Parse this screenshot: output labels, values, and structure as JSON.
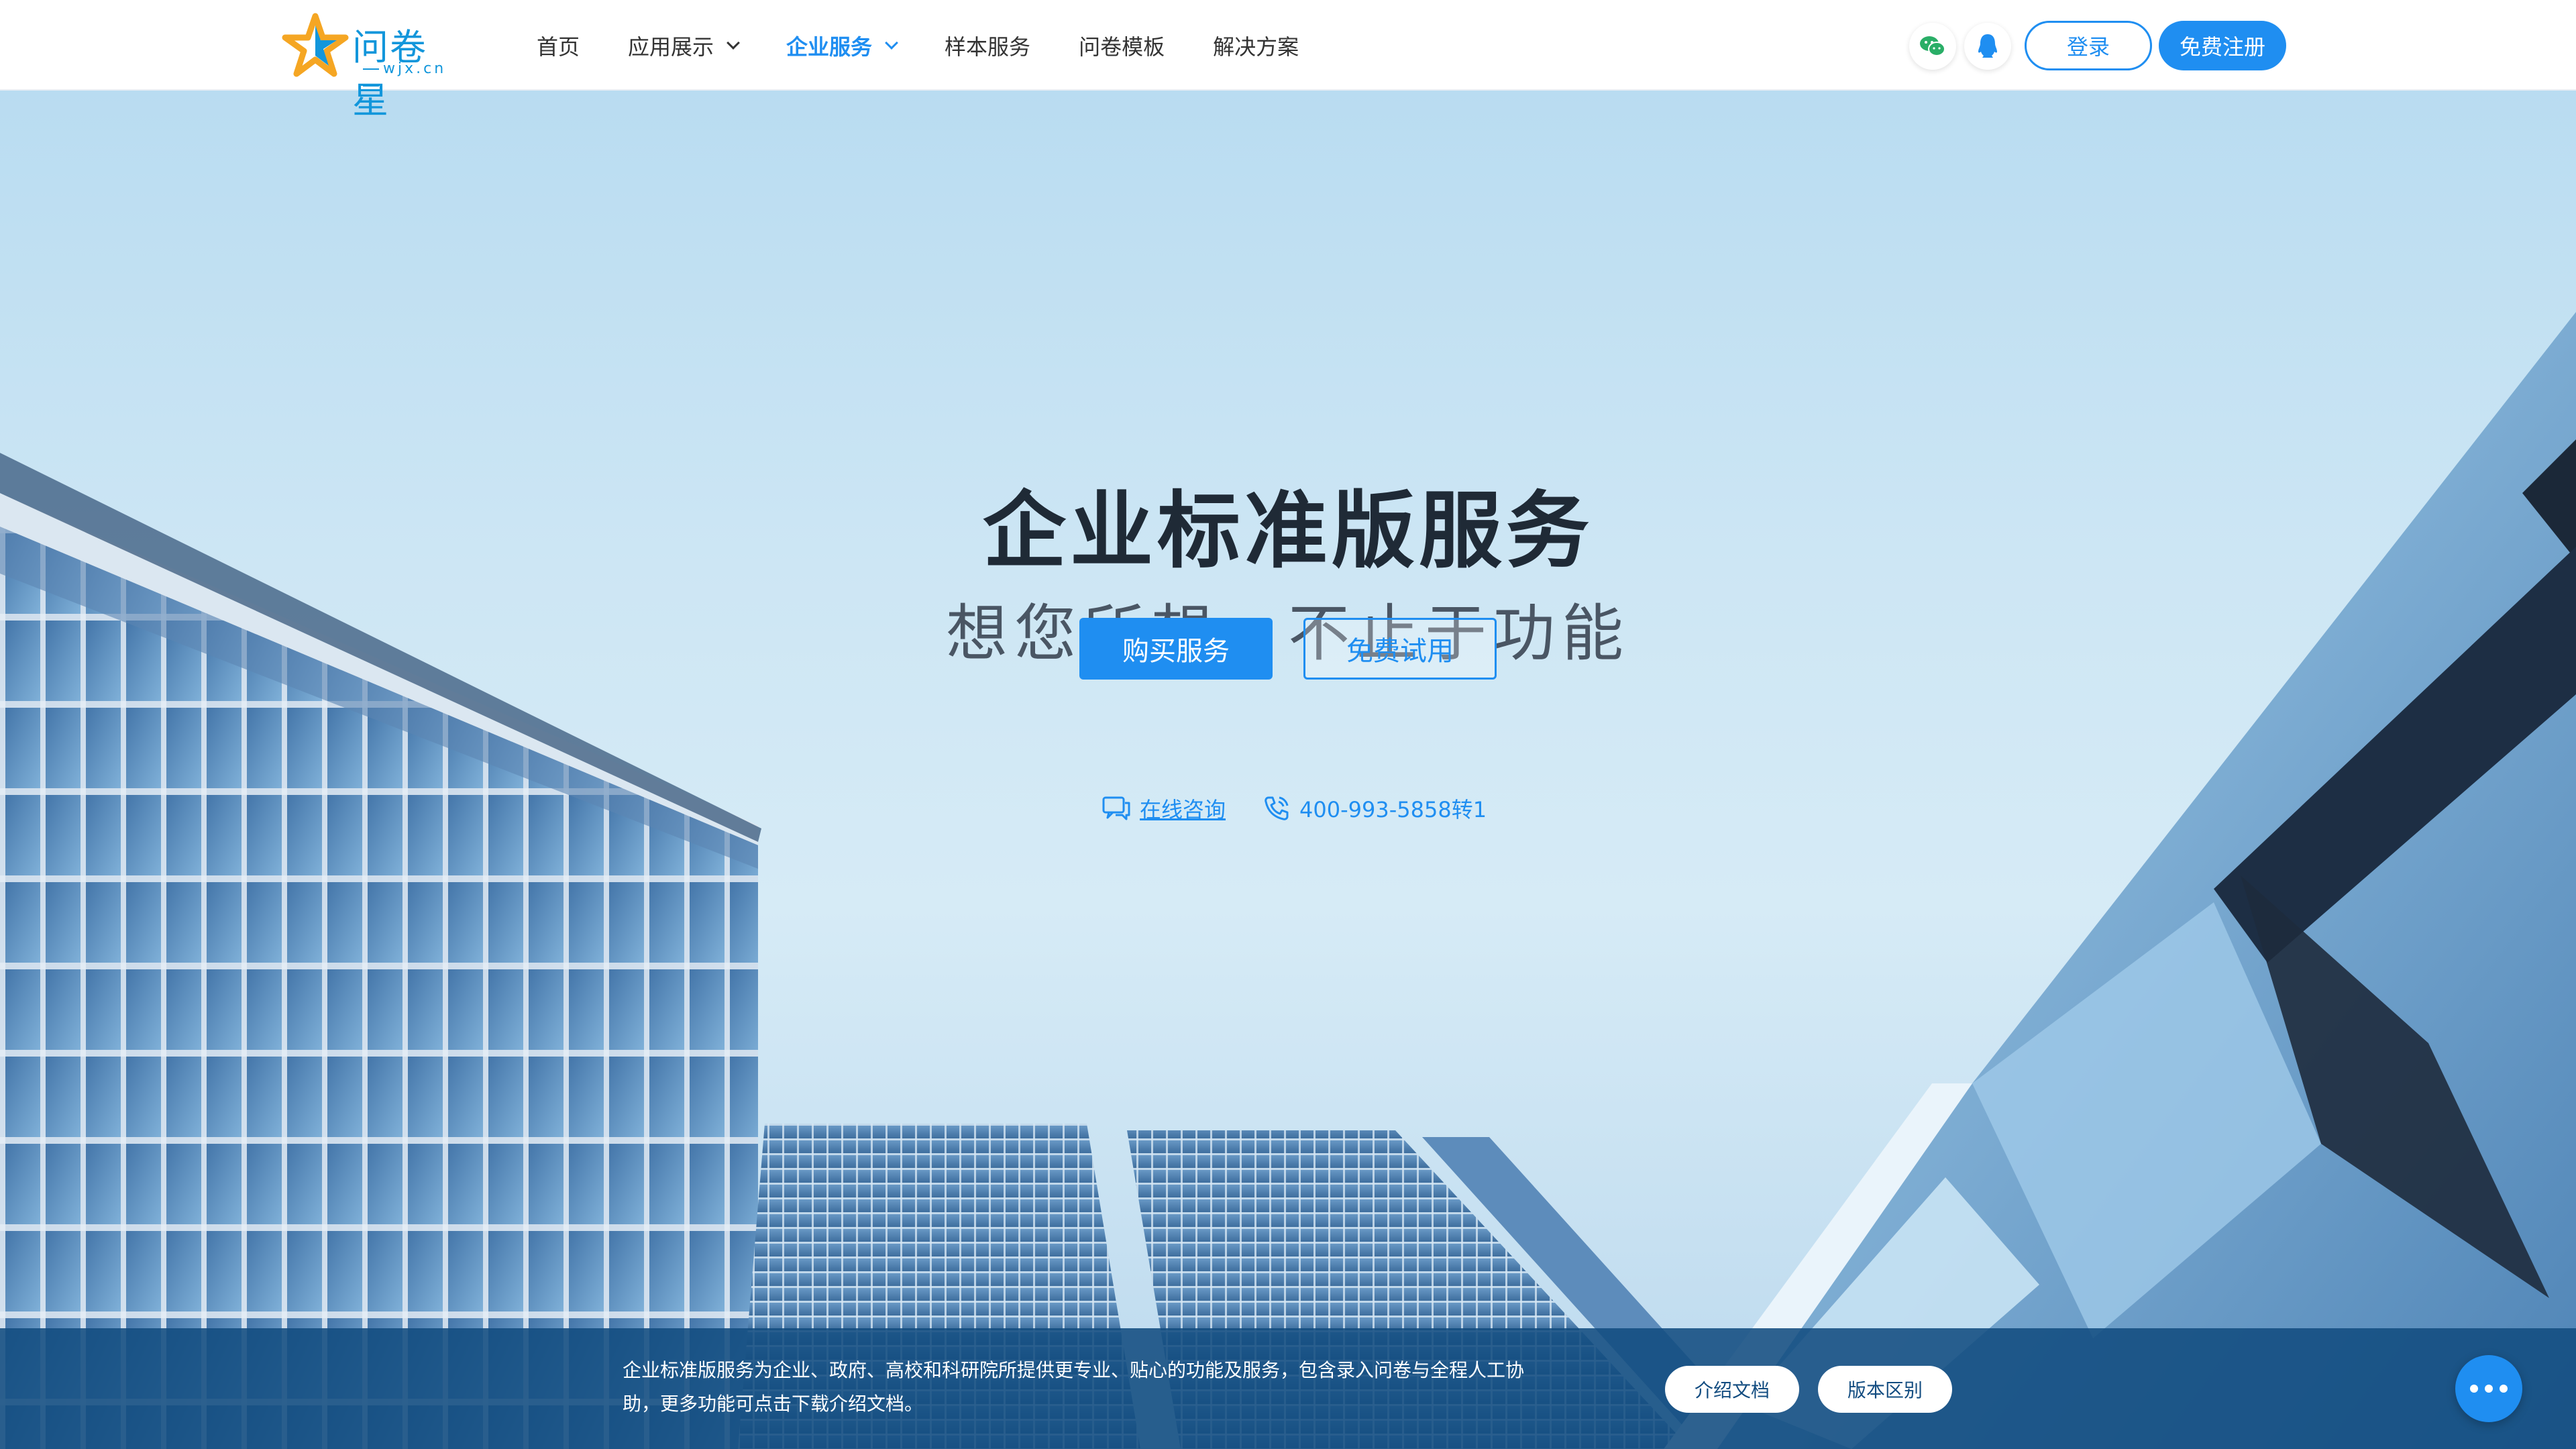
{
  "header": {
    "logo_text": "问卷星",
    "logo_sub": "wjx.cn",
    "nav": [
      {
        "label": "首页",
        "dropdown": false,
        "active": false
      },
      {
        "label": "应用展示",
        "dropdown": true,
        "active": false
      },
      {
        "label": "企业服务",
        "dropdown": true,
        "active": true
      },
      {
        "label": "样本服务",
        "dropdown": false,
        "active": false
      },
      {
        "label": "问卷模板",
        "dropdown": false,
        "active": false
      },
      {
        "label": "解决方案",
        "dropdown": false,
        "active": false
      }
    ],
    "icons": [
      "wechat-icon",
      "qq-icon"
    ],
    "login_label": "登录",
    "register_label": "免费注册"
  },
  "hero": {
    "title": "企业标准版服务",
    "subtitle": "想您所想，不止于功能",
    "buy_label": "购买服务",
    "trial_label": "免费试用",
    "online_consult": "在线咨询",
    "phone": "400-993-5858转1"
  },
  "bottom": {
    "description": "企业标准版服务为企业、政府、高校和科研院所提供更专业、贴心的功能及服务，包含录入问卷与全程人工协助，更多功能可点击下载介绍文档。",
    "intro_doc_label": "介绍文档",
    "version_diff_label": "版本区别"
  },
  "colors": {
    "accent": "#1f8ef1",
    "bottom_bar": "#124c80",
    "title_text": "#1f2a36"
  }
}
